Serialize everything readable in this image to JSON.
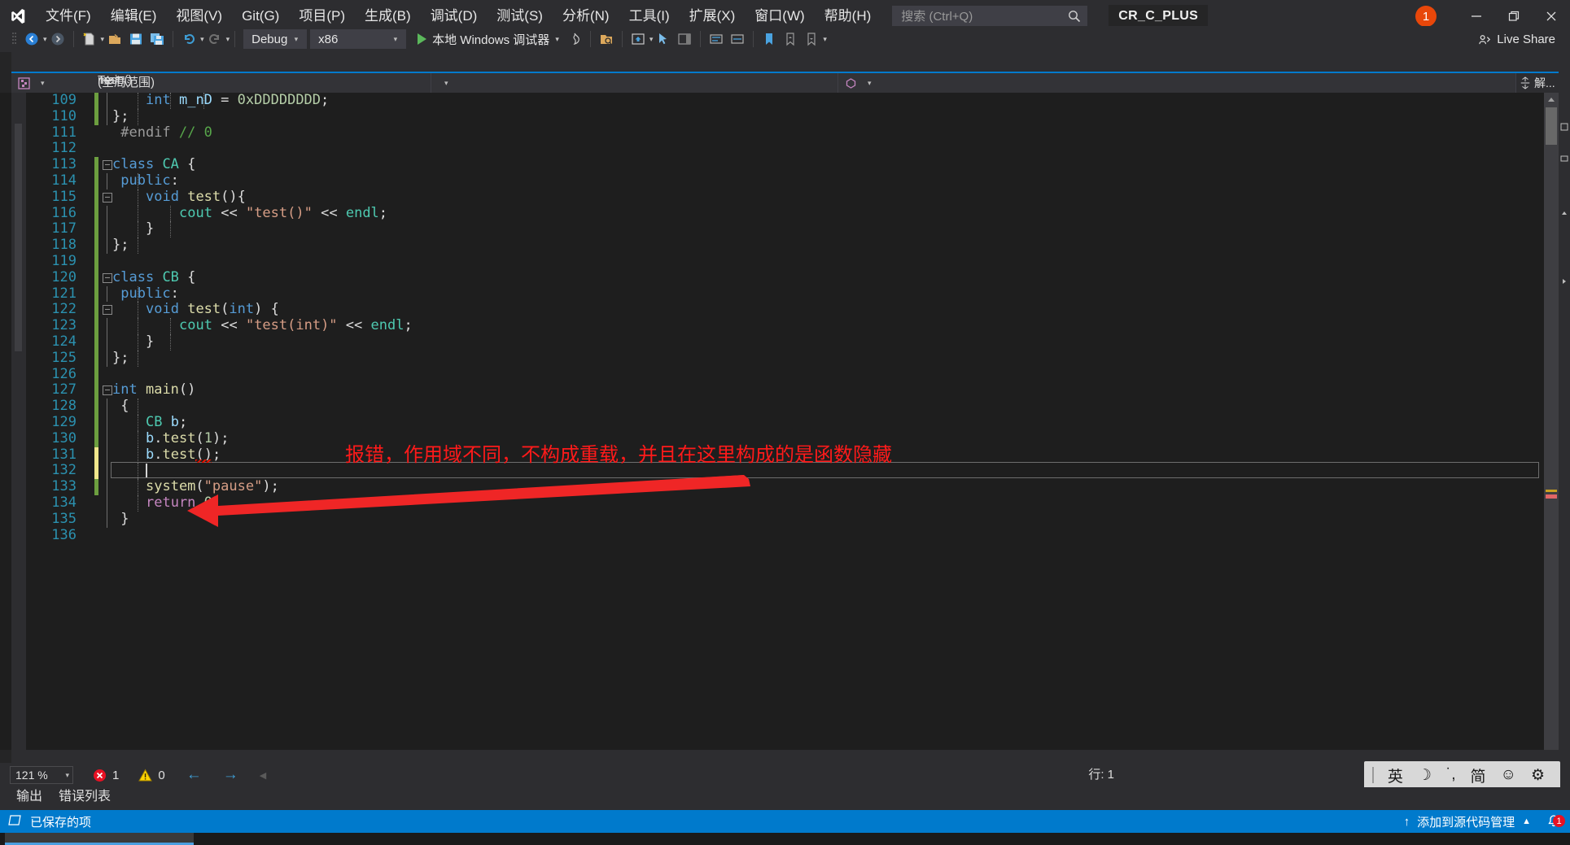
{
  "app": {
    "solution_name": "CR_C_PLUS",
    "notification_count": "1"
  },
  "menu": {
    "items": [
      {
        "text": "文件(F)"
      },
      {
        "text": "编辑(E)"
      },
      {
        "text": "视图(V)"
      },
      {
        "text": "Git(G)"
      },
      {
        "text": "项目(P)"
      },
      {
        "text": "生成(B)"
      },
      {
        "text": "调试(D)"
      },
      {
        "text": "测试(S)"
      },
      {
        "text": "分析(N)"
      },
      {
        "text": "工具(I)"
      },
      {
        "text": "扩展(X)"
      },
      {
        "text": "窗口(W)"
      },
      {
        "text": "帮助(H)"
      }
    ]
  },
  "search": {
    "placeholder": "搜索 (Ctrl+Q)",
    "value": ""
  },
  "toolbar": {
    "config_label": "Debug",
    "platform_label": "x86",
    "run_label": "本地 Windows 调试器",
    "live_share_label": "Live Share"
  },
  "navbar": {
    "project": "Test",
    "scope": "(全局范围)",
    "function": "main()",
    "rail_label": "解..."
  },
  "editor": {
    "first_line": 109,
    "lines": [
      {
        "n": 109,
        "indent": 6,
        "gutter": "saved",
        "code": "    int m_nD = 0xDDDDDDDD;"
      },
      {
        "n": 110,
        "indent": 1,
        "gutter": "saved",
        "code": "};"
      },
      {
        "n": 111,
        "indent": 0,
        "gutter": "none",
        "code": " #endif // 0"
      },
      {
        "n": 112,
        "indent": 0,
        "gutter": "none",
        "code": ""
      },
      {
        "n": 113,
        "indent": 0,
        "gutter": "saved",
        "code": "class CA {"
      },
      {
        "n": 114,
        "indent": 1,
        "gutter": "saved",
        "code": " public:"
      },
      {
        "n": 115,
        "indent": 1,
        "gutter": "saved",
        "code": "    void test(){"
      },
      {
        "n": 116,
        "indent": 2,
        "gutter": "saved",
        "code": "        cout << \"test()\" << endl;"
      },
      {
        "n": 117,
        "indent": 2,
        "gutter": "saved",
        "code": "    }"
      },
      {
        "n": 118,
        "indent": 1,
        "gutter": "saved",
        "code": "};"
      },
      {
        "n": 119,
        "indent": 0,
        "gutter": "saved",
        "code": ""
      },
      {
        "n": 120,
        "indent": 0,
        "gutter": "saved",
        "code": "class CB {"
      },
      {
        "n": 121,
        "indent": 1,
        "gutter": "saved",
        "code": " public:"
      },
      {
        "n": 122,
        "indent": 1,
        "gutter": "saved",
        "code": "    void test(int) {"
      },
      {
        "n": 123,
        "indent": 2,
        "gutter": "saved",
        "code": "        cout << \"test(int)\" << endl;"
      },
      {
        "n": 124,
        "indent": 2,
        "gutter": "saved",
        "code": "    }"
      },
      {
        "n": 125,
        "indent": 1,
        "gutter": "saved",
        "code": "};"
      },
      {
        "n": 126,
        "indent": 0,
        "gutter": "saved",
        "code": ""
      },
      {
        "n": 127,
        "indent": 0,
        "gutter": "saved",
        "code": "int main()"
      },
      {
        "n": 128,
        "indent": 1,
        "gutter": "saved",
        "code": " {"
      },
      {
        "n": 129,
        "indent": 1,
        "gutter": "saved",
        "code": "    CB b;"
      },
      {
        "n": 130,
        "indent": 1,
        "gutter": "saved",
        "code": "    b.test(1);"
      },
      {
        "n": 131,
        "indent": 1,
        "gutter": "unsaved",
        "code": "    b.test();"
      },
      {
        "n": 132,
        "indent": 1,
        "gutter": "unsaved",
        "code": ""
      },
      {
        "n": 133,
        "indent": 1,
        "gutter": "saved",
        "code": "    system(\"pause\");"
      },
      {
        "n": 134,
        "indent": 1,
        "gutter": "none",
        "code": "    return 0;"
      },
      {
        "n": 135,
        "indent": 0,
        "gutter": "none",
        "code": " }"
      },
      {
        "n": 136,
        "indent": 0,
        "gutter": "none",
        "code": ""
      }
    ],
    "annotation": "报错，作用域不同，不构成重载，并且在这里构成的是函数隐藏",
    "annotation_color": "#ff1a1a",
    "caret_line": 132
  },
  "status": {
    "zoom": "121 %",
    "error_count": "1",
    "warning_count": "0",
    "line_label": "行: 1",
    "bottom_tabs": [
      {
        "label": "输出"
      },
      {
        "label": "错误列表"
      }
    ],
    "saved_text": "已保存的项",
    "source_control_text": "添加到源代码管理",
    "notification_count": "1"
  },
  "ime": {
    "lang": "英",
    "mode": "简",
    "items": [
      "英",
      "moon",
      "punct",
      "简",
      "smiley",
      "gear"
    ]
  }
}
